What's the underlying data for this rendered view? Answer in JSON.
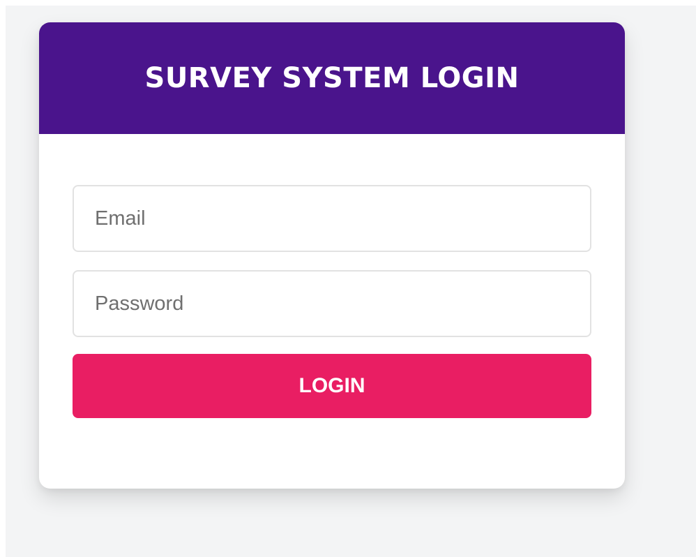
{
  "login": {
    "title": "SURVEY SYSTEM LOGIN",
    "email_placeholder": "Email",
    "password_placeholder": "Password",
    "button_label": "LOGIN"
  },
  "colors": {
    "header_bg": "#4a148c",
    "button_bg": "#e91e63",
    "page_bg": "#f3f4f5",
    "card_bg": "#ffffff"
  }
}
